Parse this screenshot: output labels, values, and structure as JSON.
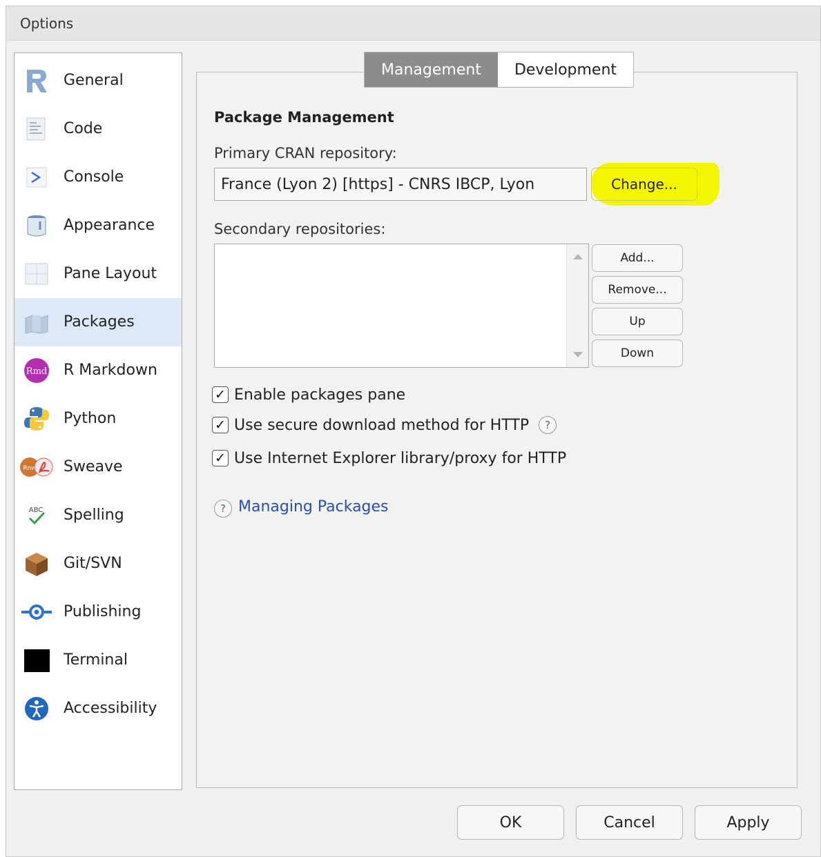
{
  "window": {
    "title": "Options"
  },
  "sidebar": {
    "items": [
      {
        "label": "General",
        "icon": "r-logo-icon"
      },
      {
        "label": "Code",
        "icon": "code-document-icon"
      },
      {
        "label": "Console",
        "icon": "console-prompt-icon"
      },
      {
        "label": "Appearance",
        "icon": "paint-bucket-icon"
      },
      {
        "label": "Pane Layout",
        "icon": "pane-layout-icon"
      },
      {
        "label": "Packages",
        "icon": "packages-icon",
        "selected": true
      },
      {
        "label": "R Markdown",
        "icon": "rmd-icon",
        "badge": "Rmd"
      },
      {
        "label": "Python",
        "icon": "python-icon"
      },
      {
        "label": "Sweave",
        "icon": "sweave-icon",
        "badge": "Rnw"
      },
      {
        "label": "Spelling",
        "icon": "spelling-icon",
        "badge": "ABC"
      },
      {
        "label": "Git/SVN",
        "icon": "git-box-icon"
      },
      {
        "label": "Publishing",
        "icon": "publishing-icon"
      },
      {
        "label": "Terminal",
        "icon": "terminal-icon"
      },
      {
        "label": "Accessibility",
        "icon": "accessibility-icon"
      }
    ]
  },
  "tabs": [
    {
      "label": "Management",
      "active": true
    },
    {
      "label": "Development",
      "active": false
    }
  ],
  "management": {
    "section_title": "Package Management",
    "primary_label": "Primary CRAN repository:",
    "primary_value": "France (Lyon 2) [https] - CNRS IBCP, Lyon",
    "change_label": "Change...",
    "secondary_label": "Secondary repositories:",
    "secondary_buttons": {
      "add": "Add...",
      "remove": "Remove...",
      "up": "Up",
      "down": "Down"
    },
    "checkboxes": [
      {
        "label": "Enable packages pane",
        "checked": true
      },
      {
        "label": "Use secure download method for HTTP",
        "checked": true,
        "help": true
      },
      {
        "label": "Use Internet Explorer library/proxy for HTTP",
        "checked": true
      }
    ],
    "help_link": "Managing Packages",
    "check_glyph": "✓",
    "help_glyph": "?"
  },
  "footer": {
    "ok": "OK",
    "cancel": "Cancel",
    "apply": "Apply"
  },
  "colors": {
    "selected_bg": "#dde9f6",
    "active_tab": "#8c8c8c",
    "highlight": "#f4f500",
    "link": "#2a4fb3"
  }
}
